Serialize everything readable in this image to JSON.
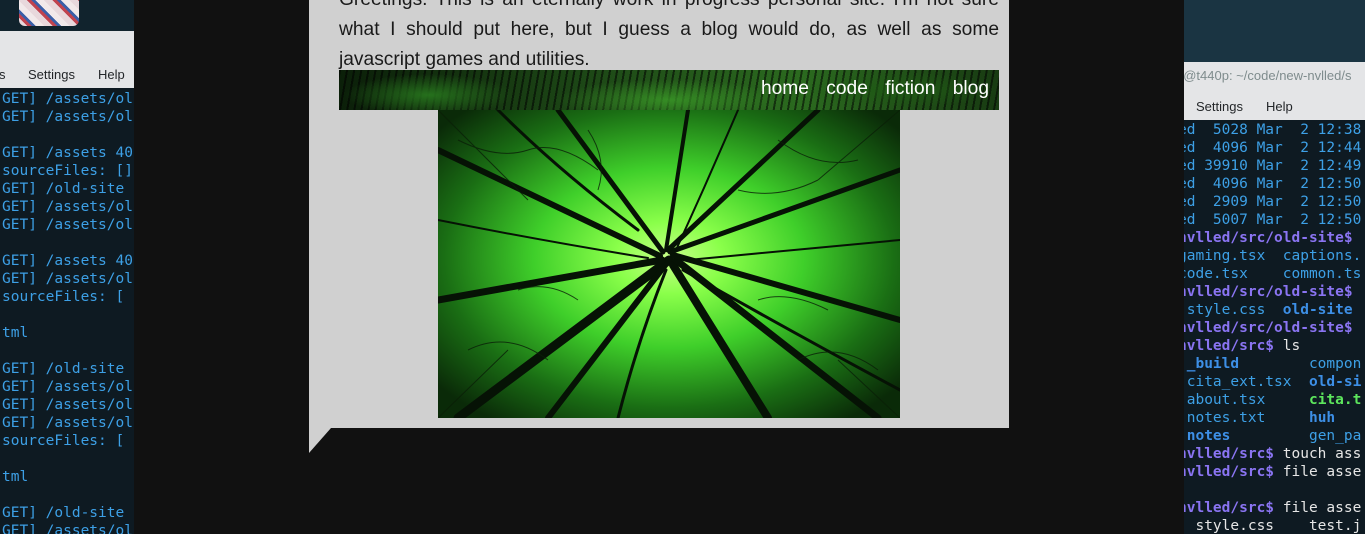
{
  "left_terminal": {
    "menu": [
      "s",
      "Settings",
      "Help"
    ],
    "lines": [
      "GET] /assets/ol",
      "GET] /assets/ol",
      "",
      "GET] /assets 40",
      "sourceFiles: []",
      "GET] /old-site",
      "GET] /assets/ol",
      "GET] /assets/ol",
      "",
      "GET] /assets 40",
      "GET] /assets/ol",
      "sourceFiles: [",
      "",
      "tml",
      "",
      "GET] /old-site",
      "GET] /assets/ol",
      "GET] /assets/ol",
      "GET] /assets/ol",
      "sourceFiles: [",
      "",
      "tml",
      "",
      "GET] /old-site",
      "GET] /assets/ol"
    ]
  },
  "right_terminal": {
    "title": "d@t440p: ~/code/new-nvlled/s",
    "menu": [
      "Settings",
      "Help"
    ],
    "listing": [
      "ed  5028 Mar  2 12:38",
      "ed  4096 Mar  2 12:44",
      "ed 39910 Mar  2 12:49",
      "ed  4096 Mar  2 12:50",
      "ed  2909 Mar  2 12:50",
      "ed  5007 Mar  2 12:50"
    ],
    "prompt_old_site": "nvlled/src/old-site$",
    "prompt_src": "nvlled/src$",
    "row_ls1": "gaming.tsx  captions.",
    "row_ls2": "code.tsx    common.ts",
    "row_css_a": " style.css  ",
    "row_css_b": "old-site",
    "cmd_ls": " ls",
    "ls_build": " _build",
    "ls_compon": "compon",
    "ls_cita_ext": " cita_ext.tsx",
    "ls_old_si": "old-si",
    "ls_about": " about.tsx",
    "ls_cita": "cita.t",
    "ls_notes_txt": " notes.txt",
    "ls_huh": "huh",
    "ls_notes": " notes",
    "ls_gen": "gen_pa",
    "cmd_touch": " touch ass",
    "cmd_file1": " file asse",
    "cmd_file2": " file asse",
    "last_line": "' style.css    test.j"
  },
  "page": {
    "intro": "Greetings. This is an eternally work in progress personal site. I'm not sure what I should put here, but I guess a blog would do, as well as some javascript games and utilities.",
    "nav": {
      "home": "home",
      "code": "code",
      "fiction": "fiction",
      "blog": "blog"
    },
    "hero_image": "forest-canopy-green-image"
  },
  "colors": {
    "overlay_bg": "#111111",
    "bubble_bg": "#d0d0d0",
    "terminal_bg": "#0e1a22",
    "terminal_text": "#3da0e6",
    "prompt_purple": "#8a74f2",
    "exec_green": "#5de65d"
  }
}
